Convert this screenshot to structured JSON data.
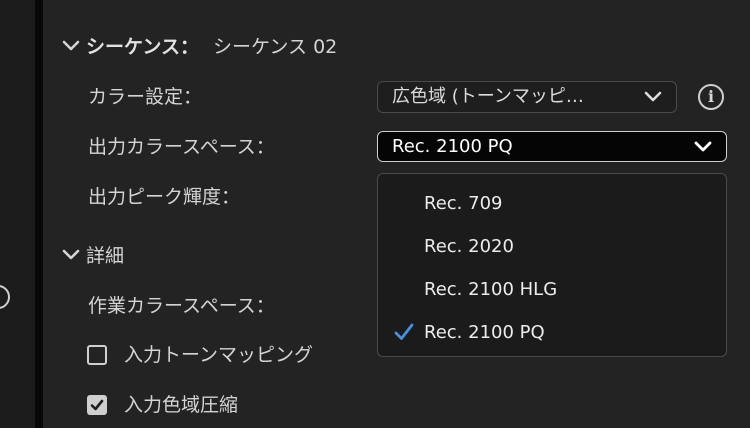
{
  "section": {
    "title": "シーケンス：",
    "name": "シーケンス 02"
  },
  "settings": {
    "color_label": "カラー設定：",
    "color_value": "広色域 (トーンマッピ…",
    "output_space_label": "出力カラースペース：",
    "output_space_value": "Rec. 2100 PQ",
    "peak_label": "出力ピーク輝度："
  },
  "details": {
    "title": "詳細",
    "working_space_label": "作業カラースペース：",
    "tone_mapping_label": "入力トーンマッピング",
    "tone_mapping_checked": false,
    "gamut_compress_label": "入力色域圧縮",
    "gamut_compress_checked": true
  },
  "dropdown": {
    "options": [
      "Rec. 709",
      "Rec. 2020",
      "Rec. 2100 HLG",
      "Rec. 2100 PQ"
    ],
    "selected": "Rec. 2100 PQ"
  },
  "icons": {
    "info": "info-icon",
    "chevron": "chevron-down-icon",
    "check": "checkmark-icon"
  },
  "colors": {
    "background": "#232323",
    "accent": "#4a90e2",
    "dropdown_bg": "#1b1b1b"
  }
}
